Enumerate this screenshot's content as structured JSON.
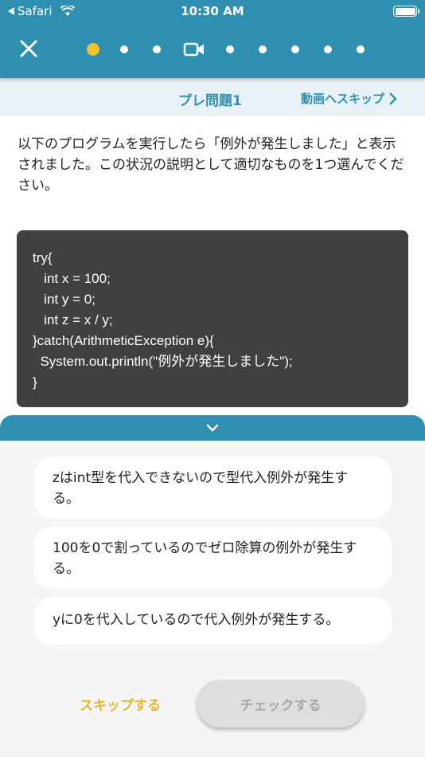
{
  "status_bar": {
    "back_label": "Safari",
    "time": "10:30 AM"
  },
  "nav": {
    "progress": {
      "total_steps": 9,
      "current_index": 0,
      "video_index": 3
    }
  },
  "subheader": {
    "title": "プレ問題1",
    "skip_video_label": "動画へスキップ"
  },
  "question": {
    "text": "以下のプログラムを実行したら「例外が発生しました」と表示されました。この状況の説明として適切なものを1つ選んでください。",
    "code_lines": [
      "try{",
      "   int x = 100;",
      "   int y = 0;",
      "   int z = x / y;",
      "}catch(ArithmeticException e){",
      "  System.out.println(\"例外が発生しました\");",
      "}"
    ]
  },
  "choices": [
    "zはint型を代入できないので型代入例外が発生する。",
    "100を0で割っているのでゼロ除算の例外が発生する。",
    "yに0を代入しているので代入例外が発生する。"
  ],
  "footer": {
    "skip_label": "スキップする",
    "check_label": "チェックする"
  },
  "colors": {
    "primary": "#2f8fb0",
    "accent": "#f2c12e",
    "skip": "#e8b62a"
  }
}
